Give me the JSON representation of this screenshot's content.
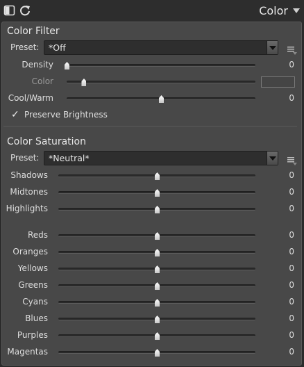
{
  "header": {
    "compare_icon": "compare-icon",
    "reset_icon": "reset-icon",
    "title": "Color",
    "dropdown_icon": "chevron-down-icon"
  },
  "color_filter": {
    "title": "Color Filter",
    "preset_label": "Preset:",
    "preset_value": "*Off",
    "menu_icon": "menu-icon",
    "sliders": [
      {
        "label": "Density",
        "value": "0",
        "position": 0.0,
        "enabled": true
      },
      {
        "label": "Color",
        "value": "",
        "position": 0.09,
        "enabled": false,
        "swatch_color": "#454545"
      },
      {
        "label": "Cool/Warm",
        "value": "0",
        "position": 0.5,
        "enabled": true
      }
    ],
    "preserve_brightness": {
      "label": "Preserve Brightness",
      "checked": true
    }
  },
  "color_saturation": {
    "title": "Color Saturation",
    "preset_label": "Preset:",
    "preset_value": "*Neutral*",
    "menu_icon": "menu-icon",
    "tonal_sliders": [
      {
        "label": "Shadows",
        "value": "0",
        "position": 0.5
      },
      {
        "label": "Midtones",
        "value": "0",
        "position": 0.5
      },
      {
        "label": "Highlights",
        "value": "0",
        "position": 0.5
      }
    ],
    "color_sliders": [
      {
        "label": "Reds",
        "value": "0",
        "position": 0.5
      },
      {
        "label": "Oranges",
        "value": "0",
        "position": 0.5
      },
      {
        "label": "Yellows",
        "value": "0",
        "position": 0.5
      },
      {
        "label": "Greens",
        "value": "0",
        "position": 0.5
      },
      {
        "label": "Cyans",
        "value": "0",
        "position": 0.5
      },
      {
        "label": "Blues",
        "value": "0",
        "position": 0.5
      },
      {
        "label": "Purples",
        "value": "0",
        "position": 0.5
      },
      {
        "label": "Magentas",
        "value": "0",
        "position": 0.5
      }
    ]
  },
  "colors": {
    "background": "#2b2b2b",
    "panel": "#484848",
    "track": "#2a2a2a",
    "text": "#dedede",
    "dim_text": "#9a9a9a"
  }
}
